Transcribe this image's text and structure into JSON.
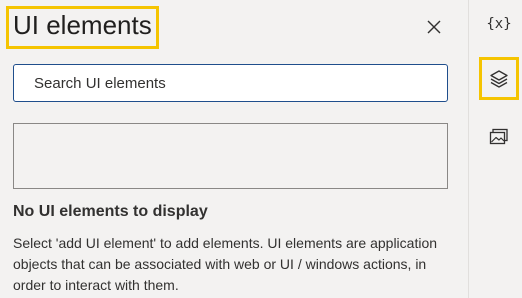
{
  "panel": {
    "title": "UI elements",
    "close_icon": "close-icon",
    "search": {
      "placeholder": "Search UI elements",
      "value": "",
      "search_icon": "search-icon"
    },
    "empty_state": {
      "title": "No UI elements to display",
      "description": "Select 'add UI element' to add elements. UI elements are application objects that can be associated with web or UI / windows actions, in order to interact with them."
    }
  },
  "side_rail": {
    "items": [
      {
        "icon": "variables-icon",
        "glyph": "{x}",
        "active": false
      },
      {
        "icon": "ui-elements-layers-icon",
        "active": true
      },
      {
        "icon": "images-icon",
        "active": false
      }
    ]
  },
  "colors": {
    "highlight": "#f5c400",
    "panel_background": "#f3f2f1",
    "search_border": "#1f4e8c",
    "text": "#323130"
  }
}
